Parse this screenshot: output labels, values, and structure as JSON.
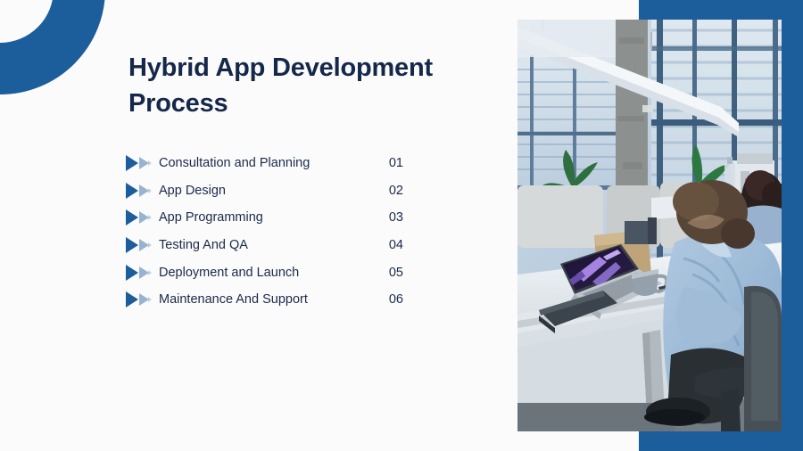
{
  "slide": {
    "background_color": "#fbfbfb",
    "accent_color": "#1b5e9b",
    "text_color": "#1b2a4a",
    "title": "Hybrid App Development Process",
    "decor": {
      "ring_name": "blue-ring-decoration",
      "panel_name": "blue-side-panel"
    },
    "photo": {
      "alt": "Office interior with people working at desks near tall windows",
      "scene": [
        "tall office windows with horizontal blinds",
        "concrete structural column",
        "suspended linear ceiling light",
        "potted green plants",
        "gray cubicle partitions",
        "white desk with open laptop",
        "gray coffee mug",
        "dark tablet case on desk",
        "person in light blue shirt seated on office chair",
        "second person with curly hair"
      ]
    },
    "steps": [
      {
        "label": "Consultation and Planning",
        "number": "01",
        "icon": "fast-forward-icon"
      },
      {
        "label": "App Design",
        "number": "02",
        "icon": "fast-forward-icon"
      },
      {
        "label": "App Programming",
        "number": "03",
        "icon": "fast-forward-icon"
      },
      {
        "label": "Testing And QA",
        "number": "04",
        "icon": "fast-forward-icon"
      },
      {
        "label": "Deployment and Launch",
        "number": "05",
        "icon": "fast-forward-icon"
      },
      {
        "label": "Maintenance And Support",
        "number": "06",
        "icon": "fast-forward-icon"
      }
    ]
  }
}
